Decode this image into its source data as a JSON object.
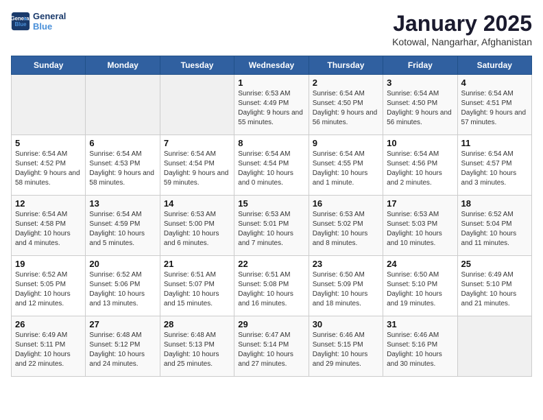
{
  "header": {
    "logo_line1": "General",
    "logo_line2": "Blue",
    "title": "January 2025",
    "subtitle": "Kotowal, Nangarhar, Afghanistan"
  },
  "days_of_week": [
    "Sunday",
    "Monday",
    "Tuesday",
    "Wednesday",
    "Thursday",
    "Friday",
    "Saturday"
  ],
  "weeks": [
    [
      {
        "day": "",
        "sunrise": "",
        "sunset": "",
        "daylight": "",
        "empty": true
      },
      {
        "day": "",
        "sunrise": "",
        "sunset": "",
        "daylight": "",
        "empty": true
      },
      {
        "day": "",
        "sunrise": "",
        "sunset": "",
        "daylight": "",
        "empty": true
      },
      {
        "day": "1",
        "sunrise": "Sunrise: 6:53 AM",
        "sunset": "Sunset: 4:49 PM",
        "daylight": "Daylight: 9 hours and 55 minutes."
      },
      {
        "day": "2",
        "sunrise": "Sunrise: 6:54 AM",
        "sunset": "Sunset: 4:50 PM",
        "daylight": "Daylight: 9 hours and 56 minutes."
      },
      {
        "day": "3",
        "sunrise": "Sunrise: 6:54 AM",
        "sunset": "Sunset: 4:50 PM",
        "daylight": "Daylight: 9 hours and 56 minutes."
      },
      {
        "day": "4",
        "sunrise": "Sunrise: 6:54 AM",
        "sunset": "Sunset: 4:51 PM",
        "daylight": "Daylight: 9 hours and 57 minutes."
      }
    ],
    [
      {
        "day": "5",
        "sunrise": "Sunrise: 6:54 AM",
        "sunset": "Sunset: 4:52 PM",
        "daylight": "Daylight: 9 hours and 58 minutes."
      },
      {
        "day": "6",
        "sunrise": "Sunrise: 6:54 AM",
        "sunset": "Sunset: 4:53 PM",
        "daylight": "Daylight: 9 hours and 58 minutes."
      },
      {
        "day": "7",
        "sunrise": "Sunrise: 6:54 AM",
        "sunset": "Sunset: 4:54 PM",
        "daylight": "Daylight: 9 hours and 59 minutes."
      },
      {
        "day": "8",
        "sunrise": "Sunrise: 6:54 AM",
        "sunset": "Sunset: 4:54 PM",
        "daylight": "Daylight: 10 hours and 0 minutes."
      },
      {
        "day": "9",
        "sunrise": "Sunrise: 6:54 AM",
        "sunset": "Sunset: 4:55 PM",
        "daylight": "Daylight: 10 hours and 1 minute."
      },
      {
        "day": "10",
        "sunrise": "Sunrise: 6:54 AM",
        "sunset": "Sunset: 4:56 PM",
        "daylight": "Daylight: 10 hours and 2 minutes."
      },
      {
        "day": "11",
        "sunrise": "Sunrise: 6:54 AM",
        "sunset": "Sunset: 4:57 PM",
        "daylight": "Daylight: 10 hours and 3 minutes."
      }
    ],
    [
      {
        "day": "12",
        "sunrise": "Sunrise: 6:54 AM",
        "sunset": "Sunset: 4:58 PM",
        "daylight": "Daylight: 10 hours and 4 minutes."
      },
      {
        "day": "13",
        "sunrise": "Sunrise: 6:54 AM",
        "sunset": "Sunset: 4:59 PM",
        "daylight": "Daylight: 10 hours and 5 minutes."
      },
      {
        "day": "14",
        "sunrise": "Sunrise: 6:53 AM",
        "sunset": "Sunset: 5:00 PM",
        "daylight": "Daylight: 10 hours and 6 minutes."
      },
      {
        "day": "15",
        "sunrise": "Sunrise: 6:53 AM",
        "sunset": "Sunset: 5:01 PM",
        "daylight": "Daylight: 10 hours and 7 minutes."
      },
      {
        "day": "16",
        "sunrise": "Sunrise: 6:53 AM",
        "sunset": "Sunset: 5:02 PM",
        "daylight": "Daylight: 10 hours and 8 minutes."
      },
      {
        "day": "17",
        "sunrise": "Sunrise: 6:53 AM",
        "sunset": "Sunset: 5:03 PM",
        "daylight": "Daylight: 10 hours and 10 minutes."
      },
      {
        "day": "18",
        "sunrise": "Sunrise: 6:52 AM",
        "sunset": "Sunset: 5:04 PM",
        "daylight": "Daylight: 10 hours and 11 minutes."
      }
    ],
    [
      {
        "day": "19",
        "sunrise": "Sunrise: 6:52 AM",
        "sunset": "Sunset: 5:05 PM",
        "daylight": "Daylight: 10 hours and 12 minutes."
      },
      {
        "day": "20",
        "sunrise": "Sunrise: 6:52 AM",
        "sunset": "Sunset: 5:06 PM",
        "daylight": "Daylight: 10 hours and 13 minutes."
      },
      {
        "day": "21",
        "sunrise": "Sunrise: 6:51 AM",
        "sunset": "Sunset: 5:07 PM",
        "daylight": "Daylight: 10 hours and 15 minutes."
      },
      {
        "day": "22",
        "sunrise": "Sunrise: 6:51 AM",
        "sunset": "Sunset: 5:08 PM",
        "daylight": "Daylight: 10 hours and 16 minutes."
      },
      {
        "day": "23",
        "sunrise": "Sunrise: 6:50 AM",
        "sunset": "Sunset: 5:09 PM",
        "daylight": "Daylight: 10 hours and 18 minutes."
      },
      {
        "day": "24",
        "sunrise": "Sunrise: 6:50 AM",
        "sunset": "Sunset: 5:10 PM",
        "daylight": "Daylight: 10 hours and 19 minutes."
      },
      {
        "day": "25",
        "sunrise": "Sunrise: 6:49 AM",
        "sunset": "Sunset: 5:10 PM",
        "daylight": "Daylight: 10 hours and 21 minutes."
      }
    ],
    [
      {
        "day": "26",
        "sunrise": "Sunrise: 6:49 AM",
        "sunset": "Sunset: 5:11 PM",
        "daylight": "Daylight: 10 hours and 22 minutes."
      },
      {
        "day": "27",
        "sunrise": "Sunrise: 6:48 AM",
        "sunset": "Sunset: 5:12 PM",
        "daylight": "Daylight: 10 hours and 24 minutes."
      },
      {
        "day": "28",
        "sunrise": "Sunrise: 6:48 AM",
        "sunset": "Sunset: 5:13 PM",
        "daylight": "Daylight: 10 hours and 25 minutes."
      },
      {
        "day": "29",
        "sunrise": "Sunrise: 6:47 AM",
        "sunset": "Sunset: 5:14 PM",
        "daylight": "Daylight: 10 hours and 27 minutes."
      },
      {
        "day": "30",
        "sunrise": "Sunrise: 6:46 AM",
        "sunset": "Sunset: 5:15 PM",
        "daylight": "Daylight: 10 hours and 29 minutes."
      },
      {
        "day": "31",
        "sunrise": "Sunrise: 6:46 AM",
        "sunset": "Sunset: 5:16 PM",
        "daylight": "Daylight: 10 hours and 30 minutes."
      },
      {
        "day": "",
        "sunrise": "",
        "sunset": "",
        "daylight": "",
        "empty": true
      }
    ]
  ]
}
